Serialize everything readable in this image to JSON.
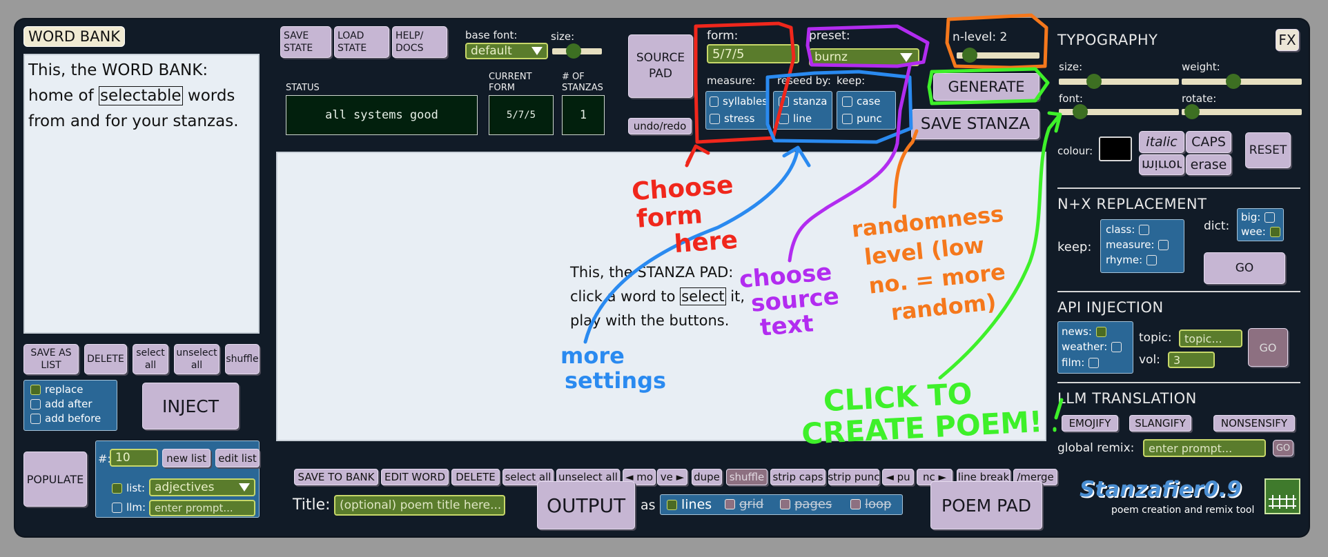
{
  "word_bank": {
    "title": "WORD BANK",
    "text_before": "This, the WORD BANK: home of ",
    "selected_word": "selectable",
    "text_after": " words from and for your stanzas.",
    "buttons": [
      "SAVE AS LIST",
      "DELETE",
      "select all",
      "unselect all",
      "shuffle"
    ],
    "options": [
      "replace",
      "add after",
      "add before"
    ],
    "inject_label": "INJECT",
    "populate_label": "POPULATE",
    "count_label": "#:",
    "count_value": "10",
    "new_list_label": "new list",
    "edit_list_label": "edit list",
    "list_label": "list:",
    "list_value": "adjectives",
    "llm_label": "llm:",
    "llm_placeholder": "enter prompt..."
  },
  "toolbar": {
    "save_state": "SAVE STATE",
    "load_state": "LOAD STATE",
    "help_docs": "HELP/ DOCS",
    "base_font_label": "base font:",
    "base_font_value": "default",
    "size_label": "size:",
    "source_pad": "SOURCE PAD",
    "undo_redo": "undo/redo"
  },
  "status": {
    "status_label": "STATUS",
    "status_value": "all systems good",
    "form_label": "CURRENT FORM",
    "form_value": "5/7/5",
    "stanzas_label": "# OF STANZAS",
    "stanzas_value": "1"
  },
  "settings": {
    "form_label": "form:",
    "form_value": "5/7/5",
    "preset_label": "preset:",
    "preset_value": "burnz",
    "measure_label": "measure:",
    "measure_opts": [
      "syllables",
      "stress"
    ],
    "reseed_label": "reseed by:",
    "reseed_opts": [
      "stanza",
      "line"
    ],
    "keep_label": "keep:",
    "keep_opts": [
      "case",
      "punc"
    ],
    "nlevel_label": "n-level: 2",
    "nlevel_value": 2,
    "generate_label": "GENERATE",
    "save_stanza_label": "SAVE STANZA"
  },
  "stanza_pad": {
    "line1": "This, the STANZA PAD:",
    "line2_before": "click a word to ",
    "line2_selected": "select",
    "line2_after": " it,",
    "line3": "play with the buttons."
  },
  "pad_buttons": [
    "SAVE TO BANK",
    "EDIT WORD",
    "DELETE",
    "select all",
    "unselect all",
    "◄ mo",
    "ve ►",
    "dupe",
    "shuffle",
    "strip caps",
    "strip punc",
    "◄ pu",
    "nc ►",
    "line break",
    "/merge"
  ],
  "output": {
    "title_label": "Title:",
    "title_placeholder": "(optional) poem title here...",
    "output_label": "OUTPUT",
    "as_label": "as",
    "modes": [
      "lines",
      "grid",
      "pages",
      "loop"
    ],
    "poem_pad_label": "POEM PAD"
  },
  "typography": {
    "header": "TYPOGRAPHY",
    "fx_label": "FX",
    "size_label": "size:",
    "weight_label": "weight:",
    "font_label": "font:",
    "rotate_label": "rotate:",
    "colour_label": "colour:",
    "italic_label": "italic",
    "caps_label": "CAPS",
    "mirror_label": "mirror",
    "erase_label": "erase",
    "reset_label": "RESET"
  },
  "nx": {
    "header": "N+X REPLACEMENT",
    "keep_label": "keep:",
    "keep_opts": [
      "class:",
      "measure:",
      "rhyme:"
    ],
    "dict_label": "dict:",
    "dict_opts": [
      "big:",
      "wee:"
    ],
    "go_label": "GO"
  },
  "api": {
    "header": "API INJECTION",
    "sources": [
      "news:",
      "weather:",
      "film:"
    ],
    "topic_label": "topic:",
    "topic_placeholder": "topic...",
    "vol_label": "vol:",
    "vol_value": "3",
    "go_label": "GO"
  },
  "llm": {
    "header": "LLM TRANSLATION",
    "buttons": [
      "EMOJIFY",
      "SLANGIFY",
      "NONSENSIFY"
    ],
    "remix_label": "global remix:",
    "remix_placeholder": "enter prompt...",
    "go_label": "GO"
  },
  "brand": {
    "name": "Stanzafier0.9",
    "tagline": "poem creation and remix tool",
    "logo_icon": "graph-paper-icon"
  },
  "annotations": {
    "form": [
      "Choose",
      "form",
      "here"
    ],
    "settings": [
      "more",
      "settings"
    ],
    "source": [
      "choose",
      "source",
      "text"
    ],
    "randomness": [
      "randomness",
      "level (low",
      "no. = more",
      "random)"
    ],
    "create": [
      "CLICK TO",
      "CREATE POEM!"
    ]
  },
  "colors": {
    "background": "#111b27",
    "lavender_button": "#c6b6d3",
    "panel_blue": "#2a6796",
    "input_green": "#5a7c2c",
    "annot_red": "#f0271c",
    "annot_blue": "#2a8af0",
    "annot_purple": "#b22cf0",
    "annot_orange": "#f5781c",
    "annot_green": "#3ef02a"
  }
}
